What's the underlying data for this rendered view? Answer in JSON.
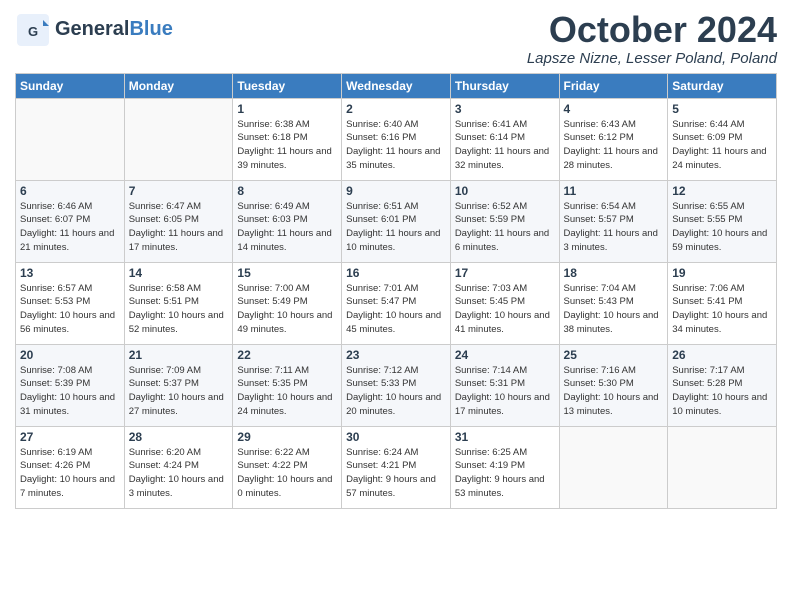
{
  "header": {
    "logo_general": "General",
    "logo_blue": "Blue",
    "month_title": "October 2024",
    "location": "Lapsze Nizne, Lesser Poland, Poland"
  },
  "days_of_week": [
    "Sunday",
    "Monday",
    "Tuesday",
    "Wednesday",
    "Thursday",
    "Friday",
    "Saturday"
  ],
  "weeks": [
    [
      {
        "day": "",
        "info": ""
      },
      {
        "day": "",
        "info": ""
      },
      {
        "day": "1",
        "info": "Sunrise: 6:38 AM\nSunset: 6:18 PM\nDaylight: 11 hours and 39 minutes."
      },
      {
        "day": "2",
        "info": "Sunrise: 6:40 AM\nSunset: 6:16 PM\nDaylight: 11 hours and 35 minutes."
      },
      {
        "day": "3",
        "info": "Sunrise: 6:41 AM\nSunset: 6:14 PM\nDaylight: 11 hours and 32 minutes."
      },
      {
        "day": "4",
        "info": "Sunrise: 6:43 AM\nSunset: 6:12 PM\nDaylight: 11 hours and 28 minutes."
      },
      {
        "day": "5",
        "info": "Sunrise: 6:44 AM\nSunset: 6:09 PM\nDaylight: 11 hours and 24 minutes."
      }
    ],
    [
      {
        "day": "6",
        "info": "Sunrise: 6:46 AM\nSunset: 6:07 PM\nDaylight: 11 hours and 21 minutes."
      },
      {
        "day": "7",
        "info": "Sunrise: 6:47 AM\nSunset: 6:05 PM\nDaylight: 11 hours and 17 minutes."
      },
      {
        "day": "8",
        "info": "Sunrise: 6:49 AM\nSunset: 6:03 PM\nDaylight: 11 hours and 14 minutes."
      },
      {
        "day": "9",
        "info": "Sunrise: 6:51 AM\nSunset: 6:01 PM\nDaylight: 11 hours and 10 minutes."
      },
      {
        "day": "10",
        "info": "Sunrise: 6:52 AM\nSunset: 5:59 PM\nDaylight: 11 hours and 6 minutes."
      },
      {
        "day": "11",
        "info": "Sunrise: 6:54 AM\nSunset: 5:57 PM\nDaylight: 11 hours and 3 minutes."
      },
      {
        "day": "12",
        "info": "Sunrise: 6:55 AM\nSunset: 5:55 PM\nDaylight: 10 hours and 59 minutes."
      }
    ],
    [
      {
        "day": "13",
        "info": "Sunrise: 6:57 AM\nSunset: 5:53 PM\nDaylight: 10 hours and 56 minutes."
      },
      {
        "day": "14",
        "info": "Sunrise: 6:58 AM\nSunset: 5:51 PM\nDaylight: 10 hours and 52 minutes."
      },
      {
        "day": "15",
        "info": "Sunrise: 7:00 AM\nSunset: 5:49 PM\nDaylight: 10 hours and 49 minutes."
      },
      {
        "day": "16",
        "info": "Sunrise: 7:01 AM\nSunset: 5:47 PM\nDaylight: 10 hours and 45 minutes."
      },
      {
        "day": "17",
        "info": "Sunrise: 7:03 AM\nSunset: 5:45 PM\nDaylight: 10 hours and 41 minutes."
      },
      {
        "day": "18",
        "info": "Sunrise: 7:04 AM\nSunset: 5:43 PM\nDaylight: 10 hours and 38 minutes."
      },
      {
        "day": "19",
        "info": "Sunrise: 7:06 AM\nSunset: 5:41 PM\nDaylight: 10 hours and 34 minutes."
      }
    ],
    [
      {
        "day": "20",
        "info": "Sunrise: 7:08 AM\nSunset: 5:39 PM\nDaylight: 10 hours and 31 minutes."
      },
      {
        "day": "21",
        "info": "Sunrise: 7:09 AM\nSunset: 5:37 PM\nDaylight: 10 hours and 27 minutes."
      },
      {
        "day": "22",
        "info": "Sunrise: 7:11 AM\nSunset: 5:35 PM\nDaylight: 10 hours and 24 minutes."
      },
      {
        "day": "23",
        "info": "Sunrise: 7:12 AM\nSunset: 5:33 PM\nDaylight: 10 hours and 20 minutes."
      },
      {
        "day": "24",
        "info": "Sunrise: 7:14 AM\nSunset: 5:31 PM\nDaylight: 10 hours and 17 minutes."
      },
      {
        "day": "25",
        "info": "Sunrise: 7:16 AM\nSunset: 5:30 PM\nDaylight: 10 hours and 13 minutes."
      },
      {
        "day": "26",
        "info": "Sunrise: 7:17 AM\nSunset: 5:28 PM\nDaylight: 10 hours and 10 minutes."
      }
    ],
    [
      {
        "day": "27",
        "info": "Sunrise: 6:19 AM\nSunset: 4:26 PM\nDaylight: 10 hours and 7 minutes."
      },
      {
        "day": "28",
        "info": "Sunrise: 6:20 AM\nSunset: 4:24 PM\nDaylight: 10 hours and 3 minutes."
      },
      {
        "day": "29",
        "info": "Sunrise: 6:22 AM\nSunset: 4:22 PM\nDaylight: 10 hours and 0 minutes."
      },
      {
        "day": "30",
        "info": "Sunrise: 6:24 AM\nSunset: 4:21 PM\nDaylight: 9 hours and 57 minutes."
      },
      {
        "day": "31",
        "info": "Sunrise: 6:25 AM\nSunset: 4:19 PM\nDaylight: 9 hours and 53 minutes."
      },
      {
        "day": "",
        "info": ""
      },
      {
        "day": "",
        "info": ""
      }
    ]
  ]
}
